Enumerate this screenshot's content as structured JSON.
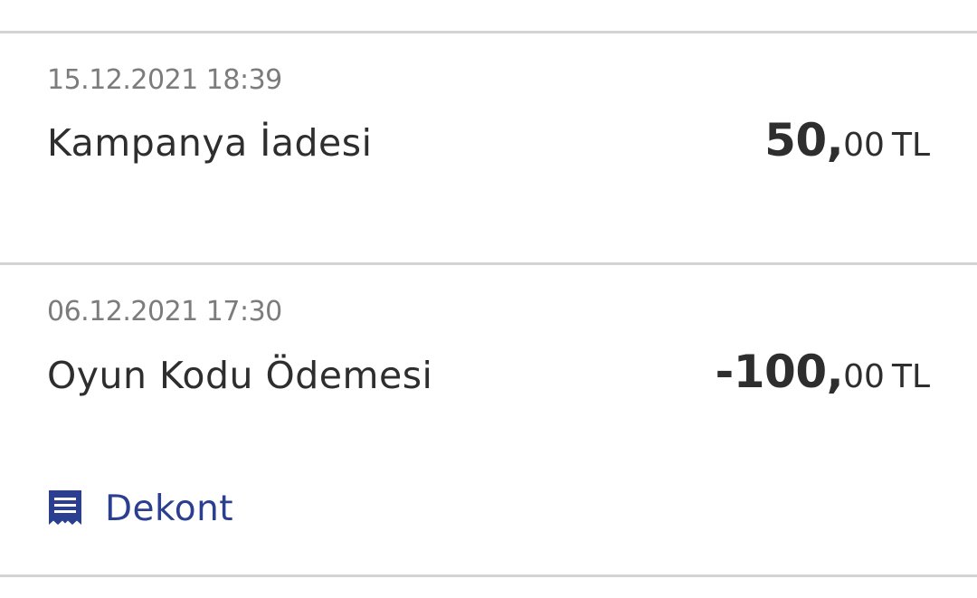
{
  "transactions": [
    {
      "date": "15.12.2021 18:39",
      "title": "Kampanya İadesi",
      "amount_int": "50,",
      "amount_dec": "00",
      "currency": "TL"
    },
    {
      "date": "06.12.2021 17:30",
      "title": "Oyun Kodu Ödemesi",
      "amount_int": "-100,",
      "amount_dec": "00",
      "currency": "TL",
      "receipt_label": "Dekont",
      "receipt_icon": "receipt-icon"
    }
  ],
  "colors": {
    "link": "#2a3f8f",
    "divider": "#d4d4d4",
    "date_text": "#7c7c7c",
    "primary_text": "#2e2e2e"
  }
}
